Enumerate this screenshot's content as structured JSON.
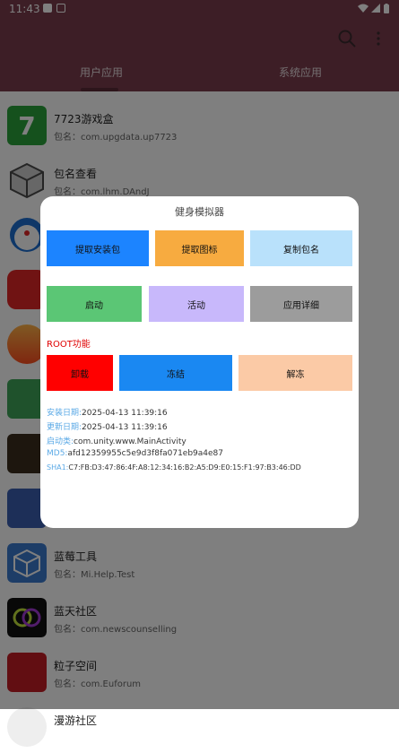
{
  "status": {
    "time": "11:43"
  },
  "tabs": [
    "用户应用",
    "系统应用"
  ],
  "apps": [
    {
      "name": "7723游戏盒",
      "pkg": "包名：com.upgdata.up7723",
      "icon": "7723-icon",
      "color": "#2aa33a"
    },
    {
      "name": "包名查看",
      "pkg": "包名：com.lhm.DAndJ",
      "icon": "box-icon",
      "color": "#4a4a4a"
    },
    {
      "name": "",
      "pkg": "",
      "icon": "doraemon-icon",
      "color": "#1c6fd1"
    },
    {
      "name": "",
      "pkg": "",
      "icon": "red-app-icon",
      "color": "#e02626"
    },
    {
      "name": "",
      "pkg": "",
      "icon": "fire-icon",
      "color": "#ff5a1f"
    },
    {
      "name": "",
      "pkg": "",
      "icon": "android-icon",
      "color": "#3ea559"
    },
    {
      "name": "",
      "pkg": "",
      "icon": "dark-game-icon",
      "color": "#3a2d1d"
    },
    {
      "name": "",
      "pkg": "",
      "icon": "audio-icon",
      "color": "#3a5fb0"
    },
    {
      "name": "蓝莓工具",
      "pkg": "包名：Mi.Help.Test",
      "icon": "cube-icon",
      "color": "#3b7bcf"
    },
    {
      "name": "蓝天社区",
      "pkg": "包名：com.newscounselling",
      "icon": "rings-icon",
      "color": "#111111"
    },
    {
      "name": "粒子空间",
      "pkg": "包名：com.Euforum",
      "icon": "particle-icon",
      "color": "#c41d24"
    },
    {
      "name": "漫游社区",
      "pkg": "",
      "icon": "roam-icon",
      "color": "#dddddd"
    }
  ],
  "dialog": {
    "title": "健身模拟器",
    "buttons_row1": [
      {
        "label": "提取安装包",
        "color": "#1c84ff"
      },
      {
        "label": "提取图标",
        "color": "#f7ab40"
      },
      {
        "label": "复制包名",
        "color": "#b9e1fb"
      }
    ],
    "buttons_row2": [
      {
        "label": "启动",
        "color": "#5bc675"
      },
      {
        "label": "活动",
        "color": "#c8b8fb"
      },
      {
        "label": "应用详细",
        "color": "#9c9c9c"
      }
    ],
    "root_label": "ROOT功能",
    "buttons_row3": [
      {
        "label": "卸载",
        "color": "#ff0000"
      },
      {
        "label": "冻结",
        "color": "#1a88f2"
      },
      {
        "label": "解冻",
        "color": "#fbcaa6"
      }
    ],
    "info": [
      {
        "key": "安装日期:",
        "value": "2025-04-13 11:39:16"
      },
      {
        "key": "更新日期:",
        "value": "2025-04-13 11:39:16"
      },
      {
        "key": "启动类:",
        "value": "com.unity.www.MainActivity"
      },
      {
        "key": "MD5:",
        "value": "afd12359955c5e9d3f8fa071eb9a4e87"
      },
      {
        "key": "SHA1:",
        "value": "C7:FB:D3:47:86:4F:A8:12:34:16:B2:A5:D9:E0:15:F1:97:B3:46:DD"
      }
    ]
  }
}
